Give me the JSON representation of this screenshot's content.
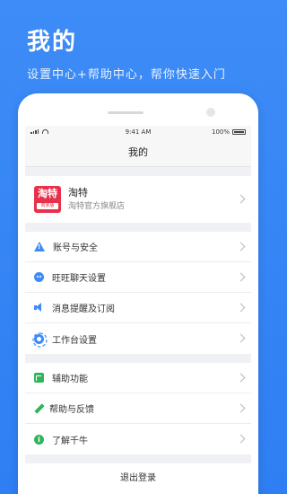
{
  "hero": {
    "title": "我的",
    "subtitle": "设置中心+帮助中心，帮你快速入门"
  },
  "statusbar": {
    "time": "9:41 AM",
    "battery": "100%"
  },
  "navbar": {
    "title": "我的"
  },
  "profile": {
    "logo_big": "淘特",
    "logo_small": "商家版",
    "name": "淘特",
    "desc": "淘特官方旗舰店"
  },
  "settings_group": [
    {
      "label": "账号与安全",
      "icon": "warning-icon",
      "color": "#3d8cf7"
    },
    {
      "label": "旺旺聊天设置",
      "icon": "chat-icon",
      "color": "#3d8cf7"
    },
    {
      "label": "消息提醒及订阅",
      "icon": "speaker-icon",
      "color": "#3d8cf7"
    },
    {
      "label": "工作台设置",
      "icon": "gear-icon",
      "color": "#3d8cf7"
    }
  ],
  "help_group": [
    {
      "label": "辅助功能",
      "icon": "assist-icon",
      "color": "#2fb55a"
    },
    {
      "label": "帮助与反馈",
      "icon": "pen-icon",
      "color": "#2fb55a"
    },
    {
      "label": "了解千牛",
      "icon": "info-icon",
      "color": "#2fb55a"
    }
  ],
  "logout_label": "退出登录",
  "colors": {
    "brand_blue": "#3d8cf7",
    "green": "#2fb55a",
    "logo_red": "#e8304a"
  }
}
